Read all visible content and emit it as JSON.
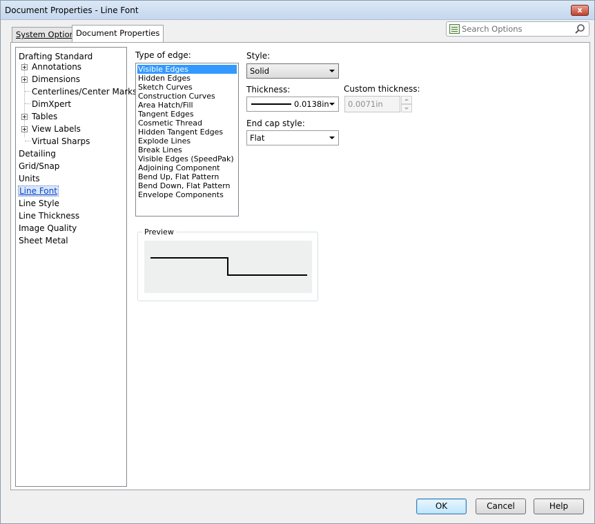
{
  "window": {
    "title": "Document Properties - Line Font",
    "close_glyph": "x"
  },
  "tabs": [
    {
      "label": "System Options",
      "mnemonic": "S",
      "rest": "ystem Options",
      "active": false
    },
    {
      "label": "Document Properties",
      "active": true
    }
  ],
  "search": {
    "placeholder": "Search Options",
    "icon": "search-options-icon"
  },
  "tree": {
    "items": [
      {
        "label": "Drafting Standard",
        "level": 0,
        "expandable": false
      },
      {
        "label": "Annotations",
        "level": 1,
        "expandable": true
      },
      {
        "label": "Dimensions",
        "level": 1,
        "expandable": true
      },
      {
        "label": "Centerlines/Center Marks",
        "level": 1,
        "expandable": false
      },
      {
        "label": "DimXpert",
        "level": 1,
        "expandable": false
      },
      {
        "label": "Tables",
        "level": 1,
        "expandable": true
      },
      {
        "label": "View Labels",
        "level": 1,
        "expandable": true
      },
      {
        "label": "Virtual Sharps",
        "level": 1,
        "expandable": false
      },
      {
        "label": "Detailing",
        "level": 0
      },
      {
        "label": "Grid/Snap",
        "level": 0
      },
      {
        "label": "Units",
        "level": 0
      },
      {
        "label": "Line Font",
        "level": 0,
        "selected": true
      },
      {
        "label": "Line Style",
        "level": 0
      },
      {
        "label": "Line Thickness",
        "level": 0
      },
      {
        "label": "Image Quality",
        "level": 0
      },
      {
        "label": "Sheet Metal",
        "level": 0
      }
    ]
  },
  "type_of_edge": {
    "label": "Type of edge:",
    "items": [
      "Visible Edges",
      "Hidden Edges",
      "Sketch Curves",
      "Construction Curves",
      "Area Hatch/Fill",
      "Tangent Edges",
      "Cosmetic Thread",
      "Hidden Tangent Edges",
      "Explode Lines",
      "Break Lines",
      "Visible Edges (SpeedPak)",
      "Adjoining Component",
      "Bend Up, Flat Pattern",
      "Bend Down, Flat Pattern",
      "Envelope Components"
    ],
    "selected": "Visible Edges"
  },
  "style": {
    "label": "Style:",
    "value": "Solid"
  },
  "thickness": {
    "label": "Thickness:",
    "value": "0.0138in"
  },
  "custom_thickness": {
    "label": "Custom thickness:",
    "value": "0.0071in"
  },
  "end_cap": {
    "label": "End cap style:",
    "value": "Flat"
  },
  "preview": {
    "label": "Preview"
  },
  "buttons": {
    "ok": "OK",
    "cancel": "Cancel",
    "help": "Help"
  }
}
